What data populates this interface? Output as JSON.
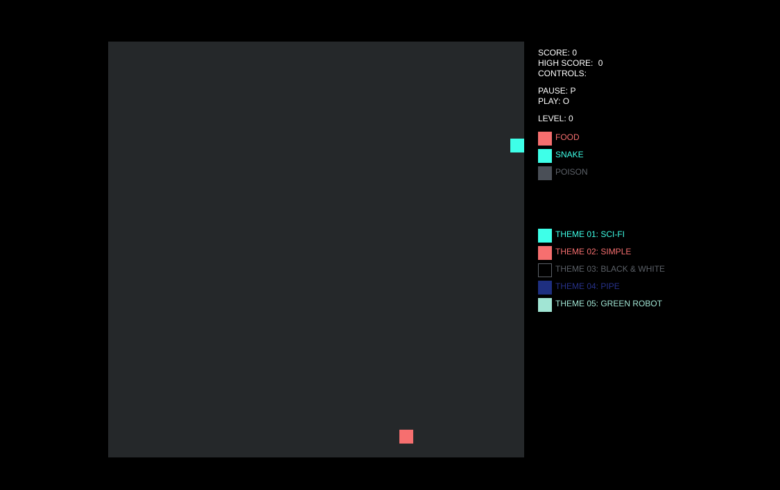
{
  "colors": {
    "background": "#000000",
    "board": "#25282a",
    "snake": "#3effe8",
    "food": "#f66f6f",
    "poison": "#4a4f57",
    "text": "#ffffff"
  },
  "hud": {
    "score_label": "SCORE:",
    "score_value": "0",
    "high_score_label": "HIGH SCORE:",
    "high_score_value": "0",
    "controls_label": "CONTROLS:",
    "pause_label": "PAUSE: P",
    "play_label": "PLAY: O",
    "level_label": "LEVEL:",
    "level_value": "0"
  },
  "legend": [
    {
      "label": "FOOD",
      "color": "#f66f6f",
      "text_color": "#f66f6f",
      "border": ""
    },
    {
      "label": "SNAKE",
      "color": "#3effe8",
      "text_color": "#3effe8",
      "border": ""
    },
    {
      "label": "POISON",
      "color": "#4a4f57",
      "text_color": "#5c6168",
      "border": ""
    }
  ],
  "themes": [
    {
      "label": "THEME 01: SCI-FI",
      "color": "#3effe8",
      "text_color": "#3effe8",
      "border": ""
    },
    {
      "label": "THEME 02: SIMPLE",
      "color": "#f66f6f",
      "text_color": "#f66f6f",
      "border": ""
    },
    {
      "label": "THEME 03: BLACK & WHITE",
      "color": "#000000",
      "text_color": "#5c6168",
      "border": "#5c6168"
    },
    {
      "label": "THEME 04: PIPE",
      "color": "#1e2f80",
      "text_color": "#27328a",
      "border": ""
    },
    {
      "label": "THEME 05: GREEN ROBOT",
      "color": "#a1e5d4",
      "text_color": "#a1e5d4",
      "border": ""
    }
  ]
}
